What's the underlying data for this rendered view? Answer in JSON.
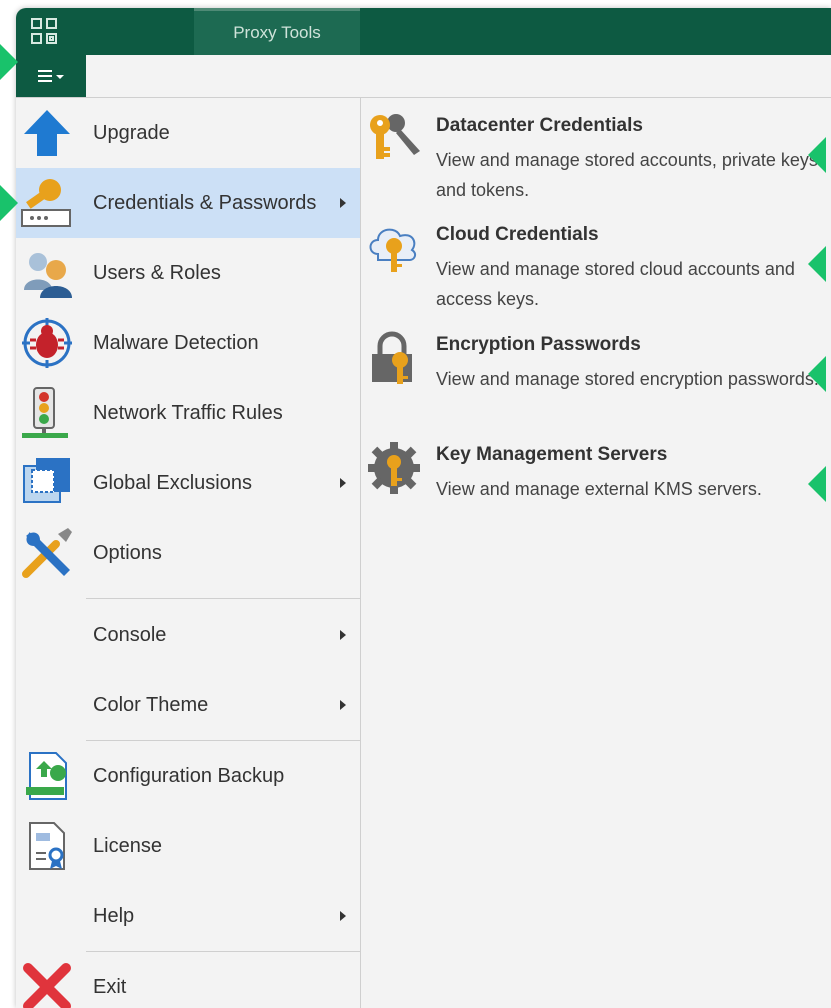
{
  "titlebar": {
    "tab_label": "Proxy Tools",
    "logo_icon": "app-logo-icon",
    "bg_color": "#0d5a42"
  },
  "toolbar": {
    "menu_icon": "hamburger-menu-icon"
  },
  "left_menu": {
    "items": [
      {
        "label": "Upgrade",
        "icon": "upgrade-arrow-icon",
        "submenu": false
      },
      {
        "label": "Credentials & Passwords",
        "icon": "key-icon",
        "submenu": true,
        "selected": true
      },
      {
        "label": "Users & Roles",
        "icon": "users-icon",
        "submenu": false
      },
      {
        "label": "Malware Detection",
        "icon": "malware-bug-icon",
        "submenu": false
      },
      {
        "label": "Network Traffic Rules",
        "icon": "traffic-light-icon",
        "submenu": false
      },
      {
        "label": "Global Exclusions",
        "icon": "exclusion-frame-icon",
        "submenu": true
      },
      {
        "label": "Options",
        "icon": "wrench-screwdriver-icon",
        "submenu": false
      },
      {
        "label": "Console",
        "icon": "",
        "submenu": true
      },
      {
        "label": "Color Theme",
        "icon": "",
        "submenu": true
      },
      {
        "label": "Configuration Backup",
        "icon": "config-backup-icon",
        "submenu": false
      },
      {
        "label": "License",
        "icon": "license-icon",
        "submenu": false
      },
      {
        "label": "Help",
        "icon": "",
        "submenu": true
      },
      {
        "label": "Exit",
        "icon": "exit-x-icon",
        "submenu": false
      }
    ],
    "selected_bg": "#cce0f6"
  },
  "submenu": {
    "items": [
      {
        "title": "Datacenter Credentials",
        "description": "View and manage stored accounts, private keys and tokens.",
        "icon": "datacenter-keys-icon"
      },
      {
        "title": "Cloud Credentials",
        "description": "View and manage stored cloud accounts and access keys.",
        "icon": "cloud-key-icon"
      },
      {
        "title": "Encryption Passwords",
        "description": "View and manage stored encryption passwords.",
        "icon": "padlock-key-icon"
      },
      {
        "title": "Key Management Servers",
        "description": "View and manage external KMS servers.",
        "icon": "gear-key-icon"
      }
    ]
  },
  "accent_green": "#19c26b"
}
